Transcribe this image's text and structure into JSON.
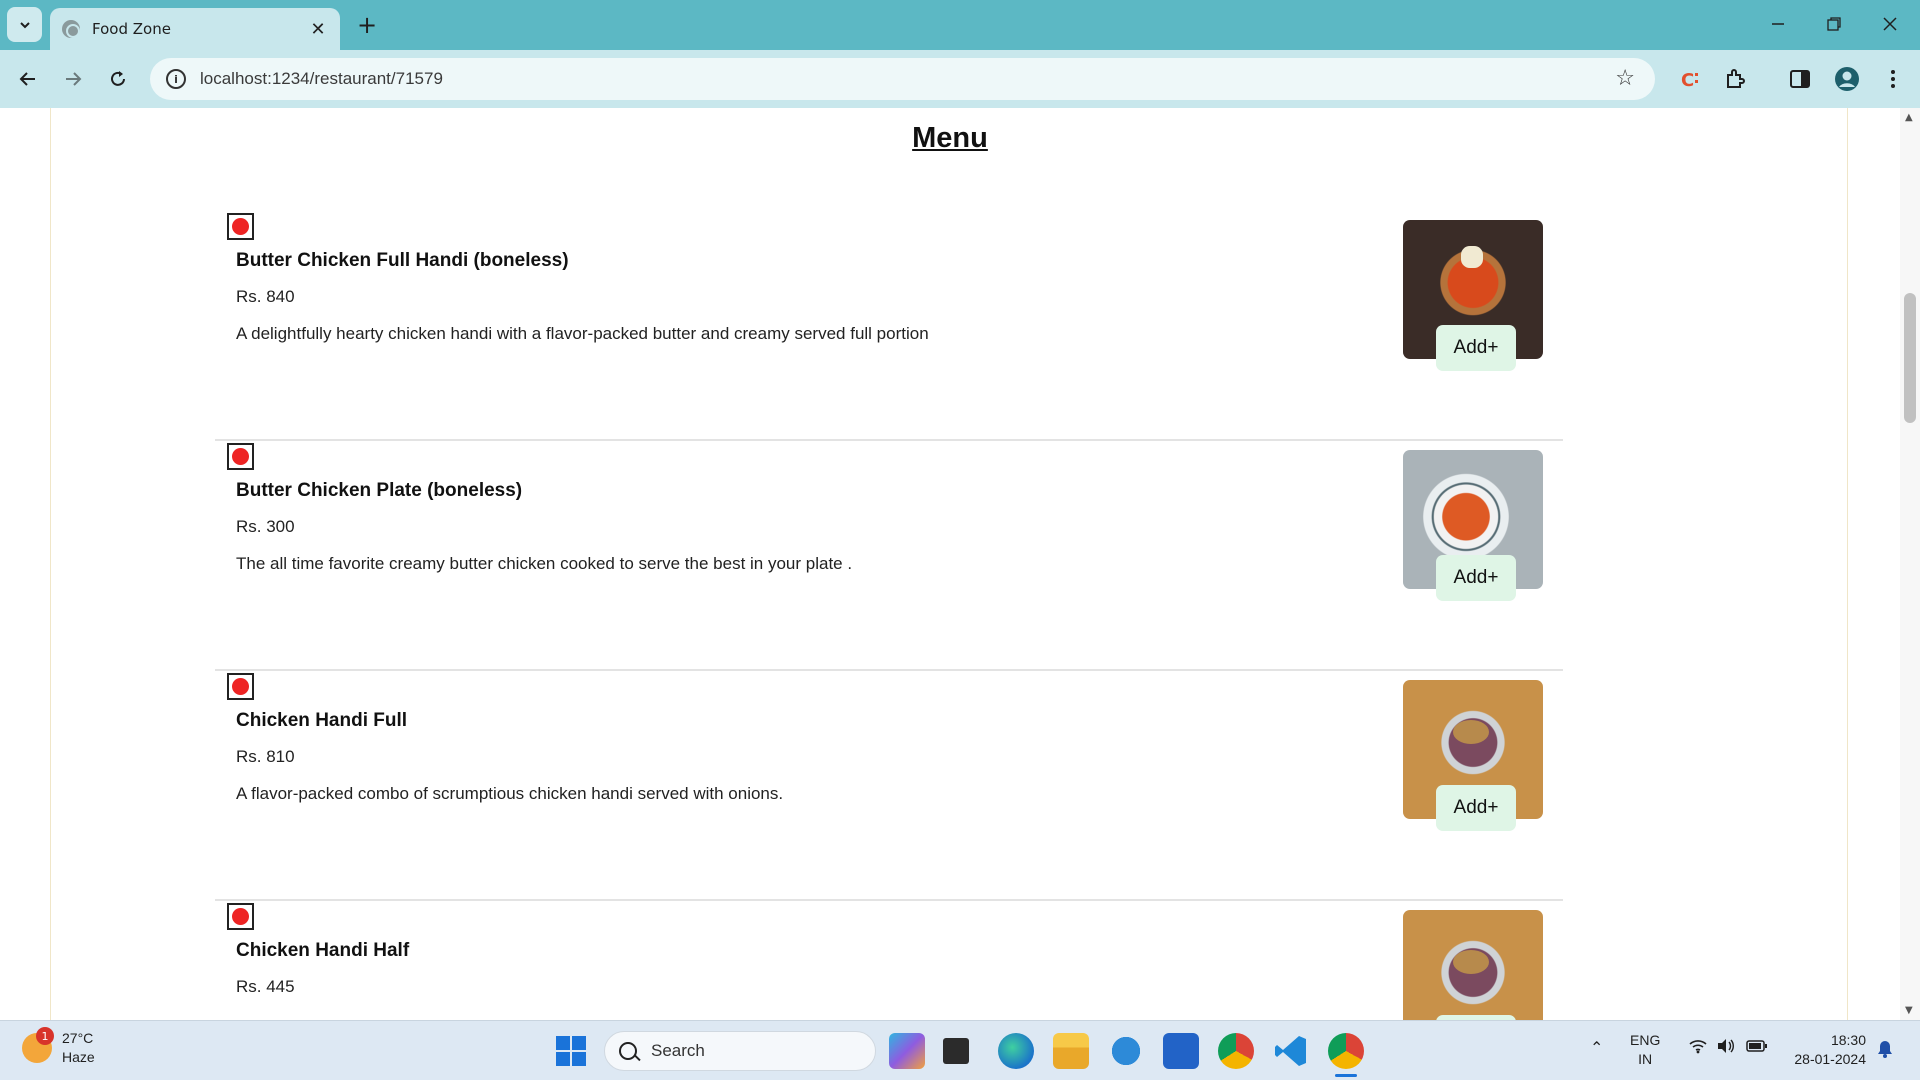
{
  "browser": {
    "tab_title": "Food Zone",
    "url": "localhost:1234/restaurant/71579",
    "new_tab_symbol": "+",
    "close_symbol": "✕"
  },
  "page": {
    "menu_title": "Menu",
    "add_label": "Add+",
    "items": [
      {
        "name": "Butter Chicken Full Handi (boneless)",
        "price": "Rs. 840",
        "description": "A delightfully hearty chicken handi with a flavor-packed butter and creamy served full portion"
      },
      {
        "name": "Butter Chicken Plate (boneless)",
        "price": "Rs. 300",
        "description": "The all time favorite creamy butter chicken cooked to serve the best in your plate ."
      },
      {
        "name": "Chicken Handi Full",
        "price": "Rs. 810",
        "description": "A flavor-packed combo of scrumptious chicken handi served with onions."
      },
      {
        "name": "Chicken Handi Half",
        "price": "Rs. 445",
        "description": ""
      }
    ]
  },
  "taskbar": {
    "weather_temp": "27°C",
    "weather_desc": "Haze",
    "weather_badge": "1",
    "search_label": "Search",
    "lang_top": "ENG",
    "lang_bottom": "IN",
    "time": "18:30",
    "date": "28-01-2024"
  }
}
